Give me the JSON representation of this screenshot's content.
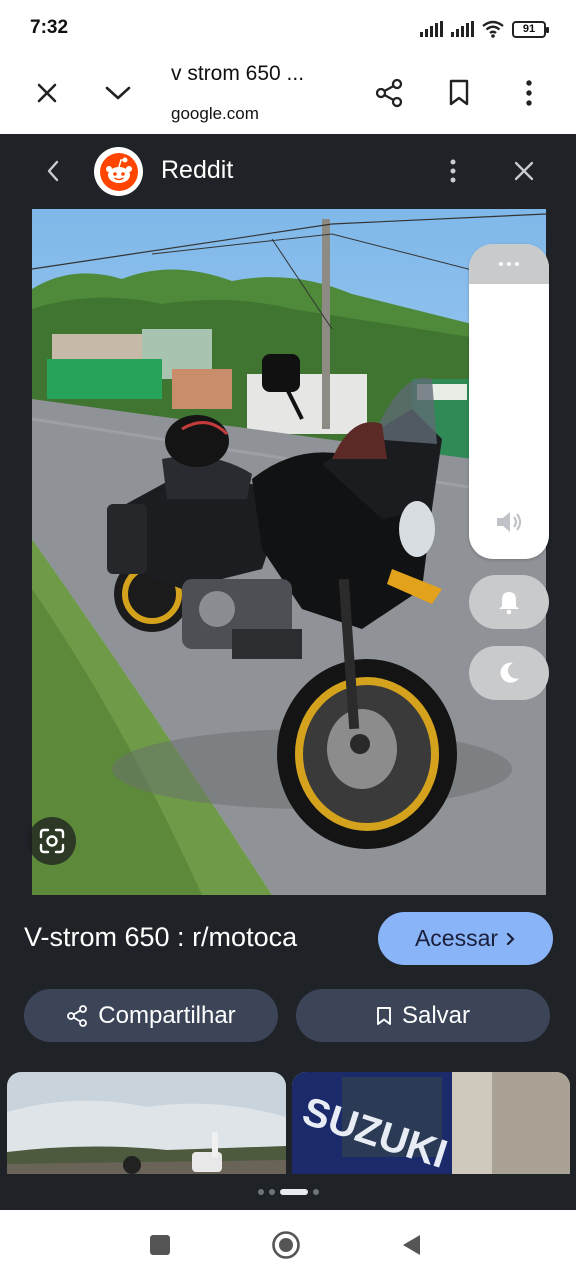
{
  "status_bar": {
    "time": "7:32",
    "battery": "91"
  },
  "browser": {
    "title": "v strom 650 ...",
    "domain": "google.com"
  },
  "panel": {
    "source_name": "Reddit",
    "caption": "V-strom 650 : r/motoca",
    "visit_label": "Acessar",
    "share_label": "Compartilhar",
    "save_label": "Salvar"
  },
  "thumbnails": [
    {
      "name": "related-image-1"
    },
    {
      "name": "related-image-2",
      "text": "SUZUKI"
    }
  ],
  "colors": {
    "panel_bg": "#1f2226",
    "accent": "#8ab4f8",
    "pill_bg": "#3b4557",
    "rim_gold": "#d4a21c"
  },
  "icons": {
    "close": "close-icon",
    "tabs": "chevron-down-icon",
    "share": "share-icon",
    "bookmark": "bookmark-icon",
    "more": "more-vert-icon",
    "back": "chevron-left-icon",
    "lens": "lens-icon",
    "volume": "volume-icon",
    "bell": "bell-icon",
    "moon": "moon-icon"
  }
}
